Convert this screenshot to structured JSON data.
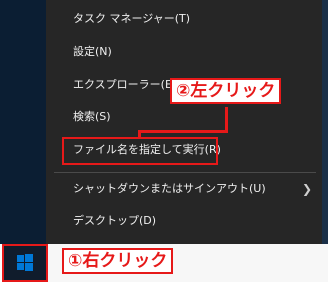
{
  "context_menu": {
    "items": [
      {
        "label": "タスク マネージャー(T)"
      },
      {
        "label": "設定(N)"
      },
      {
        "label": "エクスプローラー(E)"
      },
      {
        "label": "検索(S)"
      },
      {
        "label": "ファイル名を指定して実行(R)"
      },
      {
        "label": "シャットダウンまたはサインアウト(U)",
        "has_submenu": true
      },
      {
        "label": "デスクトップ(D)"
      }
    ]
  },
  "annotations": {
    "right_click": "①右クリック",
    "left_click": "②左クリック"
  },
  "colors": {
    "accent_red": "#e61919",
    "menu_bg": "#262626",
    "start_icon_blue": "#0078d7"
  }
}
